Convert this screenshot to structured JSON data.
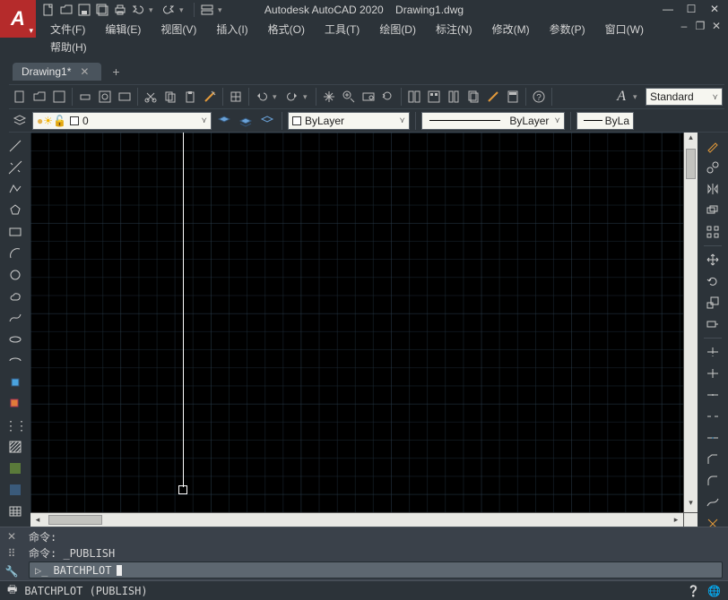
{
  "title": {
    "app": "Autodesk AutoCAD 2020",
    "doc": "Drawing1.dwg"
  },
  "qat": {
    "items": [
      "new",
      "open",
      "save",
      "saveas",
      "print",
      "undo",
      "redo",
      "workspace"
    ]
  },
  "menus": {
    "row1": [
      "文件(F)",
      "编辑(E)",
      "视图(V)",
      "插入(I)",
      "格式(O)",
      "工具(T)",
      "绘图(D)",
      "标注(N)",
      "修改(M)",
      "参数(P)",
      "窗口(W)"
    ],
    "row2": [
      "帮助(H)"
    ]
  },
  "tabs": {
    "file": "Drawing1*",
    "add": "+"
  },
  "toolbar1_style": {
    "combo": "Standard"
  },
  "toolbar2": {
    "layer": {
      "value": "0",
      "icons": [
        "bulb",
        "sun",
        "lock",
        "square"
      ]
    },
    "color": {
      "value": "ByLayer"
    },
    "linetype": {
      "value": "ByLayer"
    },
    "lineweight": {
      "value": "ByLa"
    }
  },
  "command": {
    "history": [
      "命令:",
      "命令: _PUBLISH"
    ],
    "input": "BATCHPLOT"
  },
  "status": {
    "text": "BATCHPLOT (PUBLISH)"
  },
  "icons": {
    "printer": "printer-icon",
    "help": "help-icon",
    "world": "world-icon"
  }
}
